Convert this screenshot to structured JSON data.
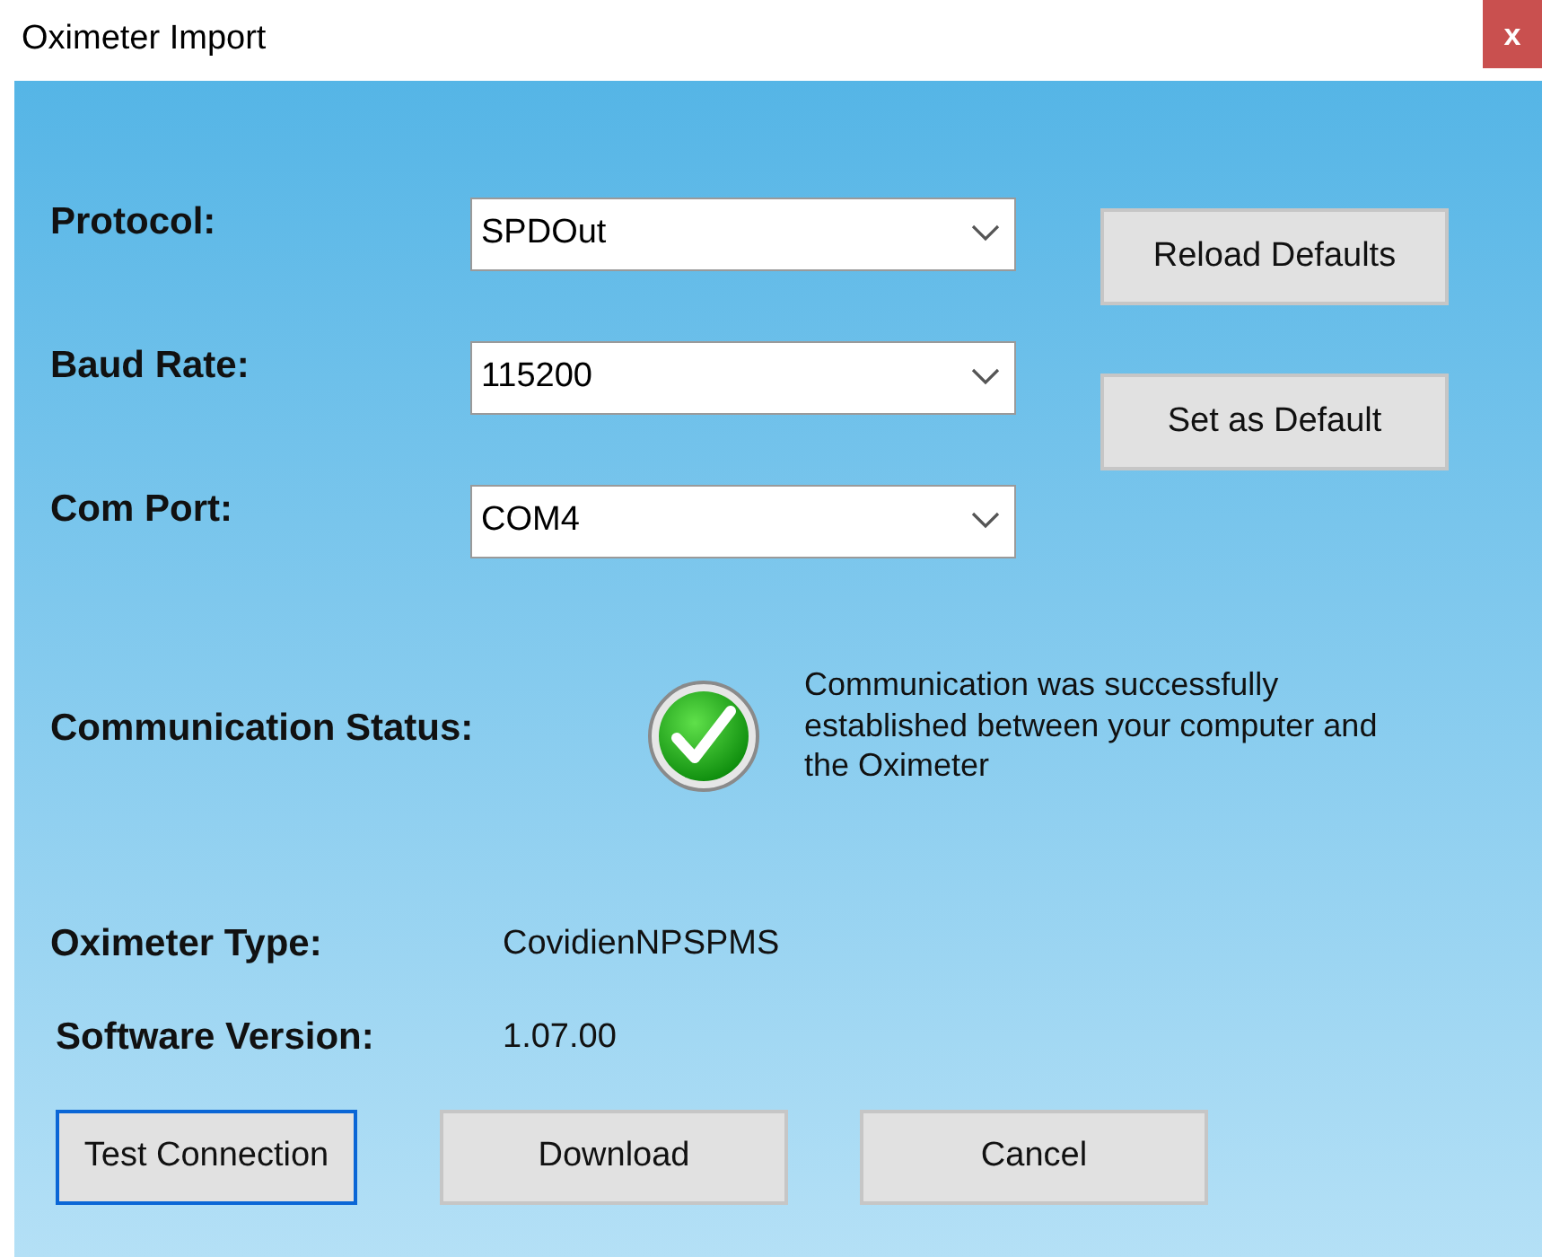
{
  "window": {
    "title": "Oximeter Import",
    "close": "x"
  },
  "settings": [
    {
      "label": "Protocol:",
      "value": "SPDOut"
    },
    {
      "label": "Baud Rate:",
      "value": "115200"
    },
    {
      "label": "Com Port:",
      "value": "COM4"
    }
  ],
  "side_buttons": [
    "Reload Defaults",
    "Set as Default"
  ],
  "status": {
    "label": "Communication Status:",
    "ok": true,
    "message": "Communication was successfully established between your computer and the Oximeter"
  },
  "info": [
    {
      "label": "Oximeter Type:",
      "value": "CovidienNPSPMS"
    },
    {
      "label": "Software Version:",
      "value": "1.07.00"
    }
  ],
  "buttons": [
    {
      "label": "Test Connection",
      "focused": true
    },
    {
      "label": "Download",
      "focused": false
    },
    {
      "label": "Cancel",
      "focused": false
    }
  ]
}
